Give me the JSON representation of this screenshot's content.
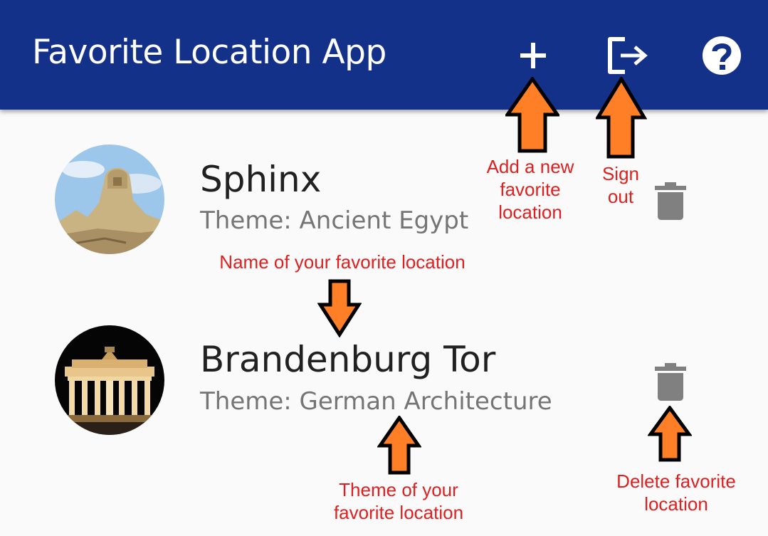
{
  "app_bar": {
    "title": "Favorite Location App",
    "actions": [
      {
        "name": "add-location-button",
        "icon": "plus-icon"
      },
      {
        "name": "sign-out-button",
        "icon": "logout-icon"
      },
      {
        "name": "help-button",
        "icon": "help-circle-icon"
      }
    ]
  },
  "locations": [
    {
      "name": "Sphinx",
      "theme": "Theme: Ancient Egypt",
      "image": "sphinx-photo"
    },
    {
      "name": "Brandenburg Tor",
      "theme": "Theme: German Architecture",
      "image": "brandenburg-gate-photo"
    }
  ],
  "annotations": {
    "add": [
      "Add a new",
      "favorite",
      "location"
    ],
    "sign_out": [
      "Sign",
      "out"
    ],
    "name": "Name of your favorite location",
    "theme": [
      "Theme of your",
      "favorite location"
    ],
    "delete": [
      "Delete favorite",
      "location"
    ]
  },
  "colors": {
    "app_bar": "#14318a",
    "annotation_text": "#e02020",
    "arrow_fill": "#ff7f27",
    "icon_gray": "#808080"
  }
}
